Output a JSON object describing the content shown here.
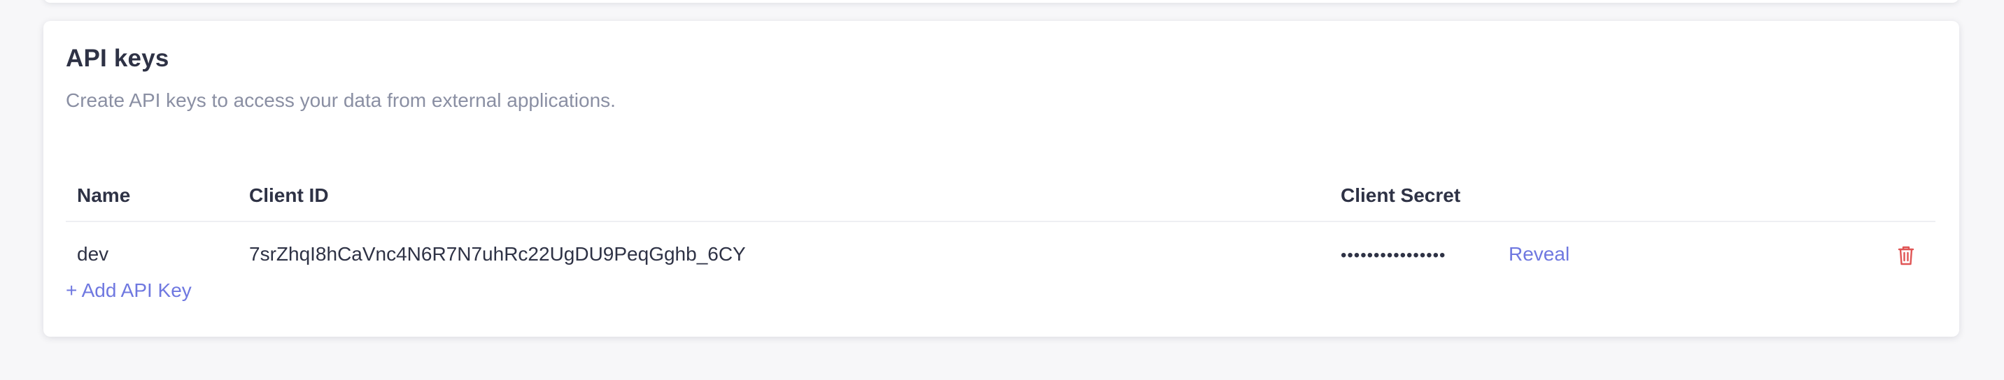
{
  "section": {
    "title": "API keys",
    "description": "Create API keys to access your data from external applications."
  },
  "table": {
    "columns": {
      "name": "Name",
      "client_id": "Client ID",
      "client_secret": "Client Secret"
    },
    "rows": [
      {
        "name": "dev",
        "client_id": "7srZhqI8hCaVnc4N6R7N7uhRc22UgDU9PeqGghb_6CY",
        "client_secret_masked": "••••••••••••••••",
        "reveal_label": "Reveal",
        "delete_icon": "trash-icon"
      }
    ]
  },
  "actions": {
    "add_label": "+ Add API Key"
  },
  "colors": {
    "link": "#6f78e0",
    "danger": "#e05555",
    "text": "#2e3245",
    "muted": "#8a8fa3"
  }
}
